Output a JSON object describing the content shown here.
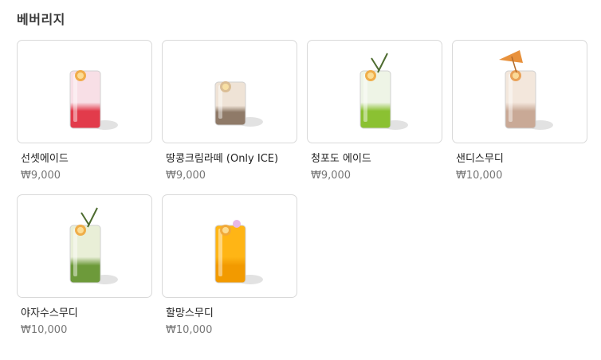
{
  "section": {
    "title": "베버리지"
  },
  "products": [
    {
      "name": "선셋에이드",
      "price": "₩9,000",
      "icon": "sunset-ade-glass-icon",
      "colors": {
        "top": "#f8dfe6",
        "bottom": "#e23b4b",
        "garnish": "#f0a63a"
      }
    },
    {
      "name": "땅콩크림라떼 (Only ICE)",
      "price": "₩9,000",
      "icon": "peanut-cream-latte-glass-icon",
      "colors": {
        "top": "#efe3d6",
        "bottom": "#8f7a68",
        "garnish": "#d8b98e"
      }
    },
    {
      "name": "청포도 에이드",
      "price": "₩9,000",
      "icon": "green-grape-ade-glass-icon",
      "colors": {
        "top": "#eef4e6",
        "bottom": "#8bc132",
        "garnish": "#f0a63a"
      }
    },
    {
      "name": "샌디스무디",
      "price": "₩10,000",
      "icon": "sandy-smoothie-glass-icon",
      "colors": {
        "top": "#f3e7dc",
        "bottom": "#c9a996",
        "garnish": "#e89a4a"
      }
    },
    {
      "name": "야자수스무디",
      "price": "₩10,000",
      "icon": "palm-smoothie-glass-icon",
      "colors": {
        "top": "#e9efd7",
        "bottom": "#6d9a3a",
        "garnish": "#f0a63a"
      }
    },
    {
      "name": "할망스무디",
      "price": "₩10,000",
      "icon": "halmang-smoothie-glass-icon",
      "colors": {
        "top": "#ffb515",
        "bottom": "#f29a00",
        "garnish": "#f0a63a"
      }
    }
  ]
}
